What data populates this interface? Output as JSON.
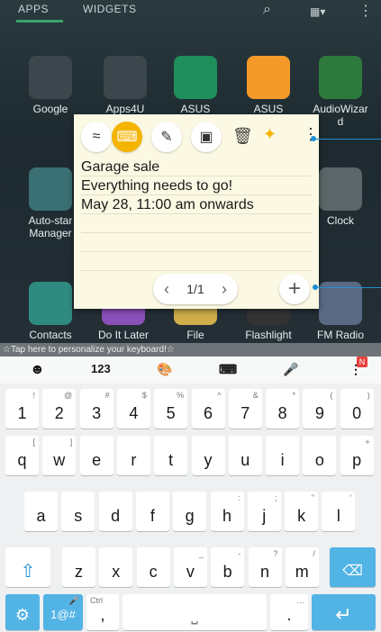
{
  "top_tabs": {
    "apps": "APPS",
    "widgets": "WIDGETS"
  },
  "apps_row1": [
    {
      "label": "Google",
      "color": "#3b474c"
    },
    {
      "label": "Apps4U",
      "color": "#3b474c"
    },
    {
      "label": "ASUS",
      "color": "#1f8e5d"
    },
    {
      "label": "ASUS",
      "color": "#f39a2a"
    },
    {
      "label": "AudioWizar\nd",
      "color": "#2e7a3d"
    }
  ],
  "apps_row2": [
    {
      "label": "Auto-star\nManager",
      "color": "#3a6f73"
    },
    {
      "label": "Clock",
      "color": "#5a6668"
    }
  ],
  "apps_row3": [
    {
      "label": "Contacts",
      "color": "#2f8a80"
    },
    {
      "label": "Do It Later",
      "color": "#8a4fb8"
    },
    {
      "label": "File",
      "color": "#cfae4b"
    },
    {
      "label": "Flashlight",
      "color": "#333"
    },
    {
      "label": "FM Radio",
      "color": "#5a6a85"
    }
  ],
  "note": {
    "lines": [
      "Garage sale",
      "Everything needs to go!",
      "May 28, 11:00 am onwards"
    ],
    "page_indicator": "1/1"
  },
  "toolbar": {
    "icons": [
      "handwriting-icon",
      "keyboard-icon",
      "text-format-icon",
      "insert-image-icon",
      "trash-icon",
      "pin-icon",
      "more-options-icon"
    ]
  },
  "hint": "☆Tap here to personalize your keyboard!☆",
  "keyboard": {
    "top_row": [
      "☻",
      "123",
      "🎨",
      "⌨",
      "🎤",
      "⋮"
    ],
    "numbers": [
      {
        "k": "1",
        "a": "!"
      },
      {
        "k": "2",
        "a": "@"
      },
      {
        "k": "3",
        "a": "#"
      },
      {
        "k": "4",
        "a": "$"
      },
      {
        "k": "5",
        "a": "%"
      },
      {
        "k": "6",
        "a": "^"
      },
      {
        "k": "7",
        "a": "&"
      },
      {
        "k": "8",
        "a": "*"
      },
      {
        "k": "9",
        "a": "("
      },
      {
        "k": "0",
        "a": ")"
      }
    ],
    "row1": [
      {
        "k": "q",
        "a": "["
      },
      {
        "k": "w",
        "a": "]"
      },
      {
        "k": "e",
        "a": ""
      },
      {
        "k": "r",
        "a": ""
      },
      {
        "k": "t",
        "a": ""
      },
      {
        "k": "y",
        "a": ""
      },
      {
        "k": "u",
        "a": ""
      },
      {
        "k": "i",
        "a": ""
      },
      {
        "k": "o",
        "a": ""
      },
      {
        "k": "p",
        "a": "+"
      }
    ],
    "row2": [
      {
        "k": "a",
        "a": ""
      },
      {
        "k": "s",
        "a": ""
      },
      {
        "k": "d",
        "a": ""
      },
      {
        "k": "f",
        "a": ""
      },
      {
        "k": "g",
        "a": ""
      },
      {
        "k": "h",
        "a": ":"
      },
      {
        "k": "j",
        "a": ";"
      },
      {
        "k": "k",
        "a": "\""
      },
      {
        "k": "l",
        "a": "'"
      }
    ],
    "row3": [
      {
        "k": "z",
        "a": ""
      },
      {
        "k": "x",
        "a": ""
      },
      {
        "k": "c",
        "a": ""
      },
      {
        "k": "v",
        "a": "_"
      },
      {
        "k": "b",
        "a": "-"
      },
      {
        "k": "n",
        "a": "?"
      },
      {
        "k": "m",
        "a": "/"
      }
    ],
    "bottom": {
      "settings": "⚙",
      "symbols": "1@#",
      "ctrl": "Ctrl",
      "comma": ",",
      "period": ".",
      "enter": "↵"
    }
  }
}
